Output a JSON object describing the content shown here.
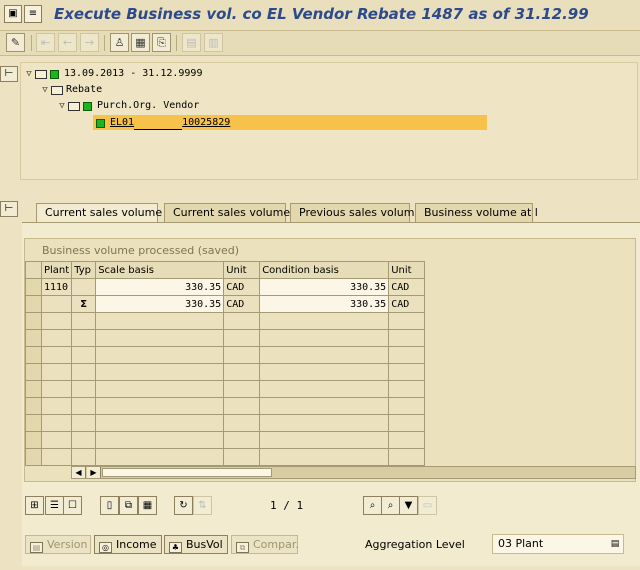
{
  "window": {
    "title": "Execute Business vol. co EL Vendor Rebate 1487 as of 31.12.99"
  },
  "tree": {
    "nodes": [
      {
        "label": "13.09.2013 - 31.12.9999",
        "status": "green"
      },
      {
        "label": "Rebate"
      },
      {
        "label": "Purch.Org. Vendor",
        "status": "green"
      },
      {
        "label": "EL01",
        "value": "10025829",
        "status": "green",
        "selected": true
      }
    ]
  },
  "tabs": [
    {
      "label": "Current sales volume",
      "active": true
    },
    {
      "label": "Current sales volume"
    },
    {
      "label": "Previous sales volum"
    },
    {
      "label": "Business volume at l"
    }
  ],
  "grid": {
    "title": "Business volume processed (saved)",
    "columns": [
      "Plant",
      "Typ",
      "Scale basis",
      "Unit",
      "Condition basis",
      "Unit"
    ],
    "rows": [
      {
        "plant": "1110",
        "typ": "",
        "scale_basis": "330.35",
        "unit1": "CAD",
        "condition_basis": "330.35",
        "unit2": "CAD"
      },
      {
        "plant": "",
        "typ": "Σ",
        "scale_basis": "330.35",
        "unit1": "CAD",
        "condition_basis": "330.35",
        "unit2": "CAD"
      }
    ]
  },
  "pager": {
    "text": "1 / 1"
  },
  "buttons": {
    "version": "Version",
    "income": "Income",
    "busvol": "BusVol",
    "compar": "Compar."
  },
  "aggregation": {
    "label": "Aggregation Level",
    "value": "03 Plant"
  },
  "colors": {
    "title": "#2c4a8c",
    "selection": "#f7c24a",
    "status_green": "#1fb31f"
  }
}
